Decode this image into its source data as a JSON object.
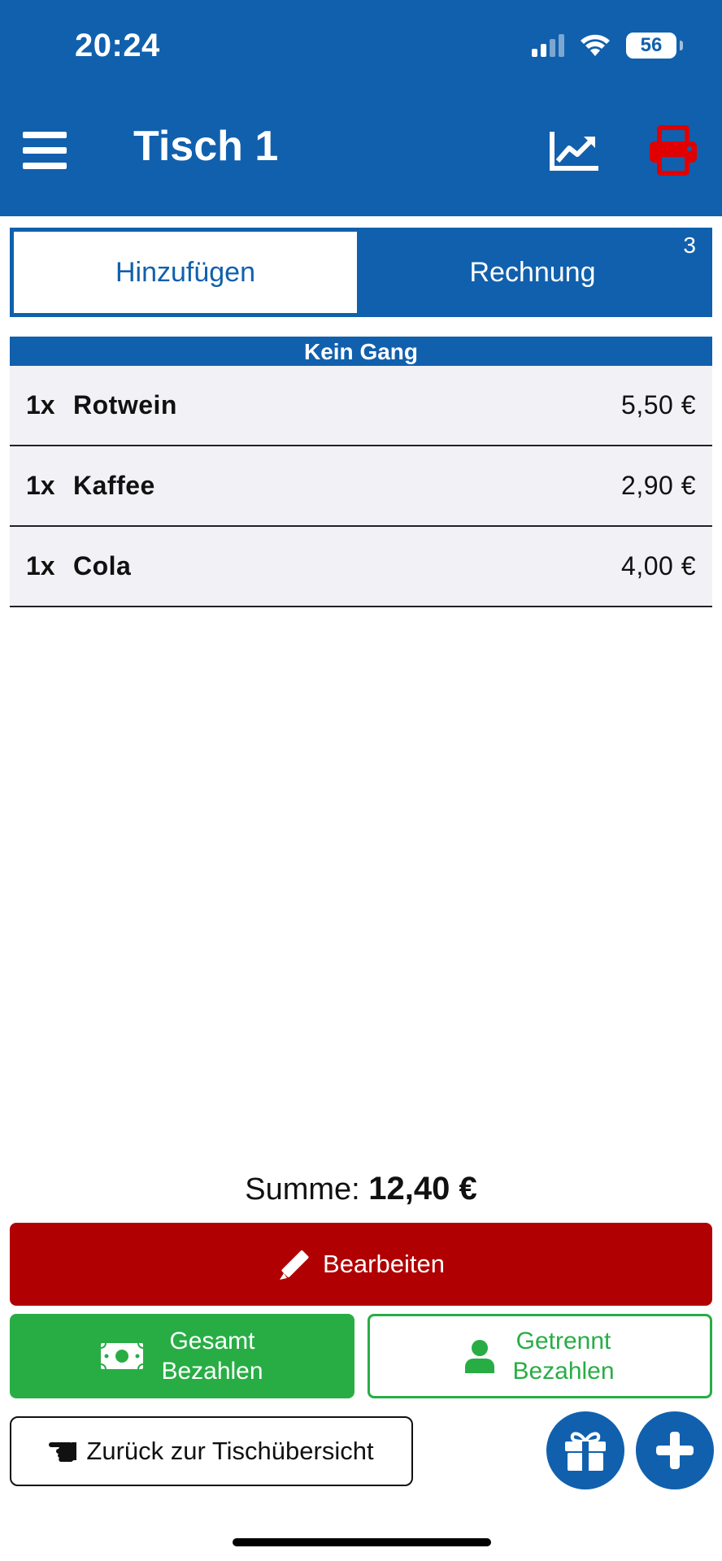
{
  "status_bar": {
    "time": "20:24",
    "battery": "56"
  },
  "header": {
    "title": "Tisch 1"
  },
  "tabs": {
    "add": "Hinzufügen",
    "bill": "Rechnung",
    "bill_badge": "3"
  },
  "course": {
    "name": "Kein Gang"
  },
  "items": [
    {
      "qty": "1x",
      "name": "Rotwein",
      "price": "5,50 €"
    },
    {
      "qty": "1x",
      "name": "Kaffee",
      "price": "2,90 €"
    },
    {
      "qty": "1x",
      "name": "Cola",
      "price": "4,00 €"
    }
  ],
  "sum": {
    "label": "Summe:",
    "value": "12,40 €"
  },
  "actions": {
    "edit": "Bearbeiten",
    "pay_total_line1": "Gesamt",
    "pay_total_line2": "Bezahlen",
    "pay_split_line1": "Getrennt",
    "pay_split_line2": "Bezahlen",
    "back": "Zurück zur Tischübersicht"
  },
  "colors": {
    "primary": "#1160ad",
    "danger": "#b00002",
    "success": "#28ad45",
    "printer": "#e00000"
  }
}
